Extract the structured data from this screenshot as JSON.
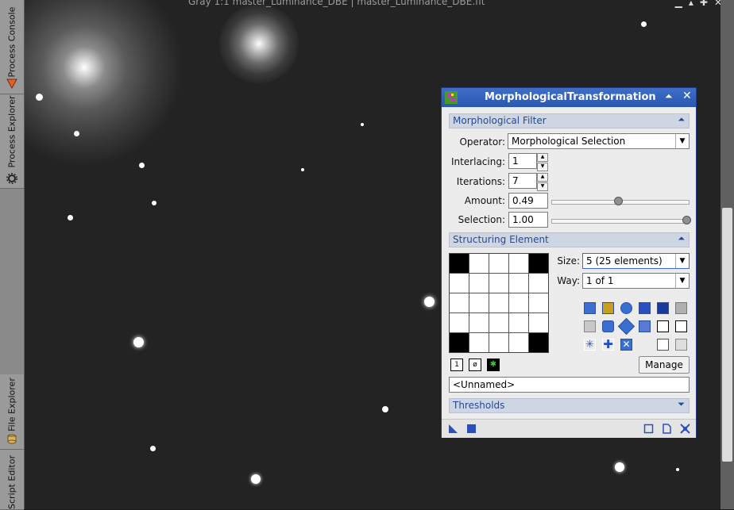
{
  "window_title": "Gray 1:1 master_Luminance_DBE | master_Luminance_DBE.fit",
  "side_tabs": [
    {
      "label": "Process Console"
    },
    {
      "label": "Process Explorer"
    },
    {
      "label": "File Explorer"
    },
    {
      "label": "Script Editor"
    }
  ],
  "dialog": {
    "title": "MorphologicalTransformation",
    "morph_section": "Morphological Filter",
    "operator_label": "Operator:",
    "operator_value": "Morphological Selection",
    "interlacing_label": "Interlacing:",
    "interlacing_value": "1",
    "iterations_label": "Iterations:",
    "iterations_value": "7",
    "amount_label": "Amount:",
    "amount_value": "0.49",
    "amount_level": 0.49,
    "selection_label": "Selection:",
    "selection_value": "1.00",
    "selection_level": 1.0,
    "struct_section": "Structuring Element",
    "size_label": "Size:",
    "size_value": "5  (25 elements)",
    "way_label": "Way:",
    "way_value": "1 of 1",
    "manage_label": "Manage",
    "element_name": "<Unnamed>",
    "thresholds_section": "Thresholds",
    "element_grid": [
      [
        1,
        0,
        0,
        0,
        1
      ],
      [
        0,
        0,
        0,
        0,
        0
      ],
      [
        0,
        0,
        0,
        0,
        0
      ],
      [
        0,
        0,
        0,
        0,
        0
      ],
      [
        1,
        0,
        0,
        0,
        1
      ]
    ]
  }
}
